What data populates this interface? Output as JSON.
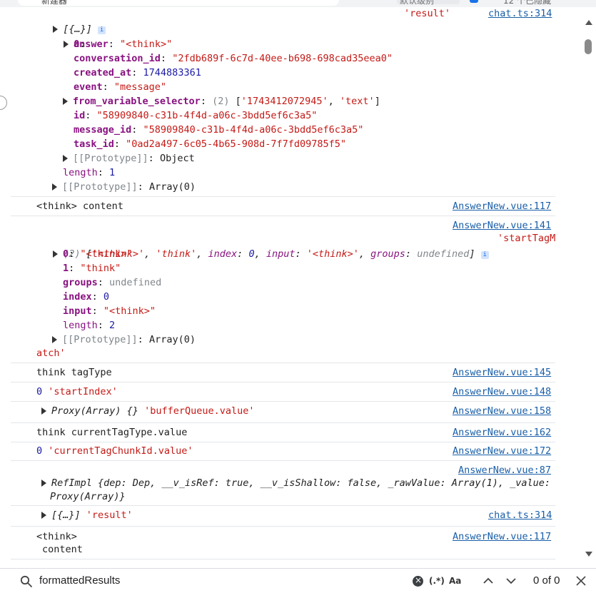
{
  "browser": {
    "tab_title": "新建器",
    "toolbar_button": "默认级别",
    "right_text": "12 个已隐藏"
  },
  "console": {
    "log1": {
      "summary": "[{…}]",
      "label": "'result'",
      "source": "chat.ts:314",
      "index_key": "0",
      "props": [
        {
          "key": "answer",
          "value": "\"<think>\"",
          "type": "str"
        },
        {
          "key": "conversation_id",
          "value": "\"2fdb689f-6c7d-40ee-b698-698cad35eea0\"",
          "type": "str"
        },
        {
          "key": "created_at",
          "value": "1744883361",
          "type": "num"
        },
        {
          "key": "event",
          "value": "\"message\"",
          "type": "str"
        },
        {
          "key": "from_variable_selector",
          "count": "(2)",
          "value_a": "'1743412072945'",
          "value_b": "'text'"
        },
        {
          "key": "id",
          "value": "\"58909840-c31b-4f4d-a06c-3bdd5ef6c3a5\"",
          "type": "str"
        },
        {
          "key": "message_id",
          "value": "\"58909840-c31b-4f4d-a06c-3bdd5ef6c3a5\"",
          "type": "str"
        },
        {
          "key": "task_id",
          "value": "\"0ad2a497-6c05-4b65-908d-7f7fd09785f5\"",
          "type": "str"
        }
      ],
      "proto_object": "[[Prototype]]",
      "proto_object_value": "Object",
      "length_key": "length",
      "length_value": "1",
      "proto_array": "[[Prototype]]",
      "proto_array_value": "Array(0)"
    },
    "log2": {
      "text": "<think> content",
      "source": "AnswerNew.vue:117"
    },
    "log3": {
      "source": "AnswerNew.vue:141",
      "count": "(2)",
      "items_open": "[",
      "item0": "'<think>'",
      "item1": "'think'",
      "index_key": "index",
      "index_val": "0",
      "input_key": "input",
      "input_val": "'<think>'",
      "groups_key": "groups",
      "groups_val": "undefined",
      "items_close": "]",
      "label_start": "'startTagM",
      "label_end": "atch'",
      "props": [
        {
          "key": "0",
          "value": "\"<think>\"",
          "type": "str"
        },
        {
          "key": "1",
          "value": "\"think\"",
          "type": "str"
        },
        {
          "key": "groups",
          "value": "undefined",
          "type": "gray"
        },
        {
          "key": "index",
          "value": "0",
          "type": "num"
        },
        {
          "key": "input",
          "value": "\"<think>\"",
          "type": "str"
        },
        {
          "key": "length",
          "value": "2",
          "type": "num"
        }
      ],
      "proto": "[[Prototype]]",
      "proto_value": "Array(0)"
    },
    "log4": {
      "text": "think tagType",
      "source": "AnswerNew.vue:145"
    },
    "log5": {
      "num": "0",
      "label": "'startIndex'",
      "source": "AnswerNew.vue:148"
    },
    "log6": {
      "obj": "Proxy(Array) {}",
      "label": "'bufferQueue.value'",
      "source": "AnswerNew.vue:158"
    },
    "log7": {
      "text": "think currentTagType.value",
      "source": "AnswerNew.vue:162"
    },
    "log8": {
      "num": "0",
      "label": "'currentTagChunkId.value'",
      "source": "AnswerNew.vue:172"
    },
    "log9": {
      "source": "AnswerNew.vue:87",
      "line1": "RefImpl {dep: Dep, __v_isRef: true, __v_isShallow: false, _rawValue: Array(1), _value:",
      "line2": "Proxy(Array)}"
    },
    "log10": {
      "summary": "[{…}]",
      "label": "'result'",
      "source": "chat.ts:314"
    },
    "log11": {
      "line1": "<think>",
      "line2": "content",
      "source": "AnswerNew.vue:117"
    }
  },
  "search": {
    "query": "formattedResults",
    "regex_label": "(.*)",
    "case_label": "Aa",
    "result_count": "0 of 0"
  }
}
